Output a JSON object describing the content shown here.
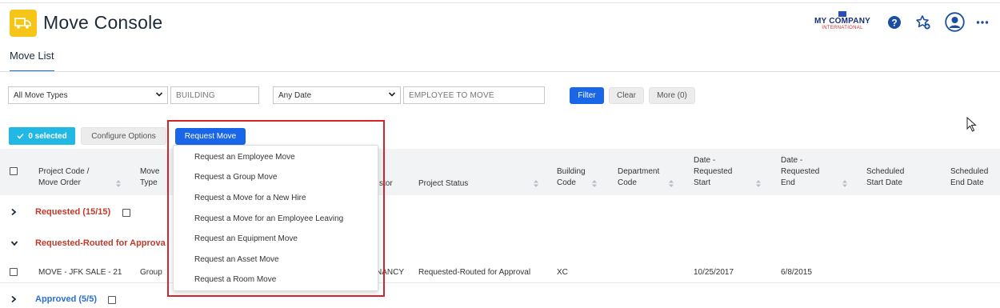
{
  "header": {
    "title": "Move Console",
    "app_icon": "truck-icon",
    "company_logo": {
      "name": "MY COMPANY",
      "sub": "INTERNATIONAL"
    },
    "icons": [
      "help-icon",
      "favorites-add-icon",
      "user-avatar-icon",
      "more-icon"
    ]
  },
  "tabs": [
    {
      "label": "Move List",
      "active": true
    }
  ],
  "filters": {
    "move_types": "All Move Types",
    "building_placeholder": "BUILDING",
    "date": "Any Date",
    "employee_placeholder": "EMPLOYEE TO MOVE",
    "filter_label": "Filter",
    "clear_label": "Clear",
    "more_label": "More (0)"
  },
  "actions": {
    "selected_label": "0 selected",
    "configure_label": "Configure Options",
    "request_label": "Request Move"
  },
  "request_menu": [
    "Request an Employee Move",
    "Request a Group Move",
    "Request a Move for a New Hire",
    "Request a Move for an Employee Leaving",
    "Request an Equipment Move",
    "Request an Asset Move",
    "Request a Room Move"
  ],
  "table": {
    "columns": {
      "project_code_1": "Project Code /",
      "project_code_2": "Move Order",
      "move_type_1": "Move",
      "move_type_2": "Type",
      "requestor_tail": "stor",
      "project_status": "Project Status",
      "building_code_1": "Building",
      "building_code_2": "Code",
      "dept_code_1": "Department",
      "dept_code_2": "Code",
      "req_start_1": "Date -",
      "req_start_2": "Requested",
      "req_start_3": "Start",
      "req_end_1": "Date -",
      "req_end_2": "Requested",
      "req_end_3": "End",
      "sched_start_1": "Scheduled",
      "sched_start_2": "Start Date",
      "sched_end_1": "Scheduled",
      "sched_end_2": "End Date"
    },
    "groups": {
      "requested": "Requested (15/15)",
      "routed": "Requested-Routed for Approva",
      "approved": "Approved (5/5)"
    },
    "row": {
      "project_code": "MOVE - JFK SALE - 21",
      "move_type": "Group",
      "requestor": "NANCY",
      "project_status": "Requested-Routed for Approval",
      "building_code": "XC",
      "req_start": "10/25/2017",
      "req_end": "6/8/2015"
    }
  },
  "colors": {
    "accent": "#1a66e8",
    "selected_badge": "#21b8e6",
    "requested_group": "#c0392b",
    "approved_group": "#2a6fd6",
    "highlight": "#d6232a"
  }
}
